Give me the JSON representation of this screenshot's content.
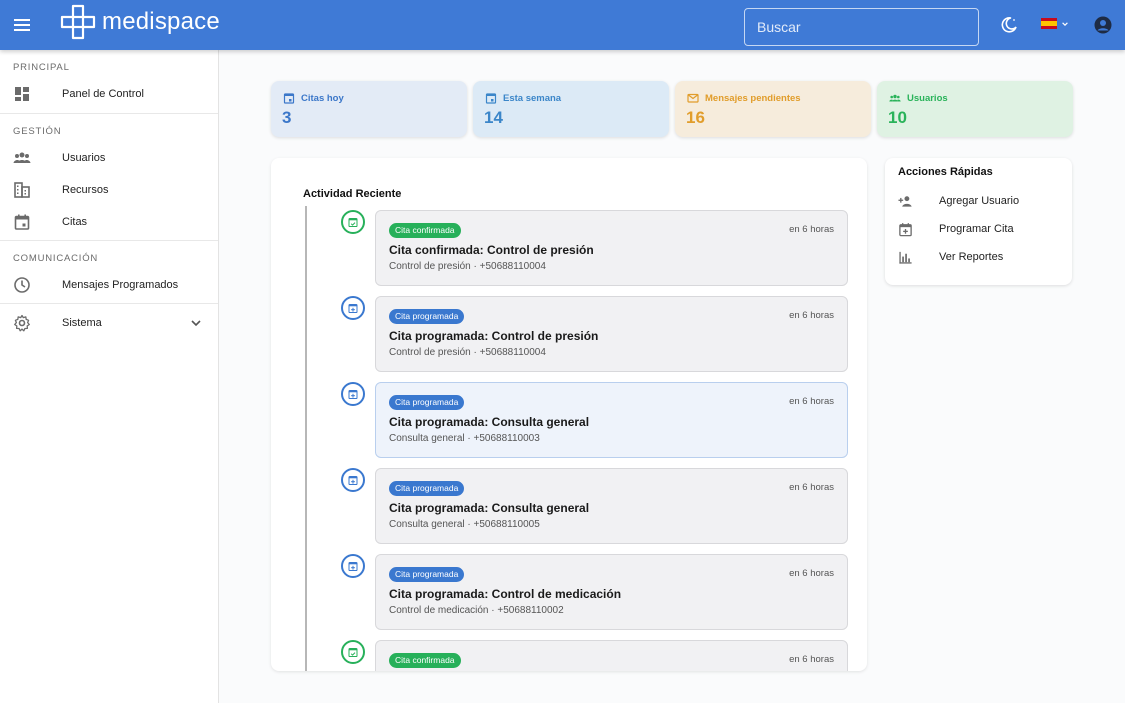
{
  "header": {
    "app_name": "medispace",
    "search_placeholder": "Buscar",
    "colors": {
      "header_bg": "#3f7ad6"
    }
  },
  "sidebar": {
    "sections": [
      "PRINCIPAL",
      "GESTIÓN",
      "COMUNICACIÓN"
    ],
    "items": [
      {
        "label": "Panel de Control",
        "icon": "dashboard-icon"
      },
      {
        "label": "Usuarios",
        "icon": "users-icon"
      },
      {
        "label": "Recursos",
        "icon": "building-icon"
      },
      {
        "label": "Citas",
        "icon": "calendar-icon"
      },
      {
        "label": "Mensajes Programados",
        "icon": "clock-icon"
      },
      {
        "label": "Sistema",
        "icon": "gear-icon"
      }
    ]
  },
  "stats": [
    {
      "label": "Citas hoy",
      "value": "3",
      "color": "#3b77c9",
      "bg": "#e3ebf6"
    },
    {
      "label": "Esta semana",
      "value": "14",
      "color": "#3b86c9",
      "bg": "#dceaf6"
    },
    {
      "label": "Mensajes pendientes",
      "value": "16",
      "color": "#e19d2b",
      "bg": "#f6ecdc"
    },
    {
      "label": "Usuarios",
      "value": "10",
      "color": "#2ab35a",
      "bg": "#dff2e3"
    }
  ],
  "activity": {
    "title": "Actividad Reciente",
    "items": [
      {
        "badge": "Cita confirmada",
        "status": "confirmed",
        "time": "en 6 horas",
        "title": "Cita confirmada: Control de presión",
        "subtitle": "Control de presión · +50688110004"
      },
      {
        "badge": "Cita programada",
        "status": "scheduled",
        "time": "en 6 horas",
        "title": "Cita programada: Control de presión",
        "subtitle": "Control de presión · +50688110004"
      },
      {
        "badge": "Cita programada",
        "status": "scheduled",
        "time": "en 6 horas",
        "title": "Cita programada: Consulta general",
        "subtitle": "Consulta general · +50688110003"
      },
      {
        "badge": "Cita programada",
        "status": "scheduled",
        "time": "en 6 horas",
        "title": "Cita programada: Consulta general",
        "subtitle": "Consulta general · +50688110005"
      },
      {
        "badge": "Cita programada",
        "status": "scheduled",
        "time": "en 6 horas",
        "title": "Cita programada: Control de medicación",
        "subtitle": "Control de medicación · +50688110002"
      },
      {
        "badge": "Cita confirmada",
        "status": "confirmed",
        "time": "en 6 horas",
        "title": "",
        "subtitle": ""
      }
    ],
    "colors": {
      "confirmed": "#27b05a",
      "scheduled": "#3a78cf"
    }
  },
  "quick_actions": {
    "title": "Acciones Rápidas",
    "items": [
      {
        "label": "Agregar Usuario",
        "icon": "add-user-icon"
      },
      {
        "label": "Programar Cita",
        "icon": "calendar-add-icon"
      },
      {
        "label": "Ver Reportes",
        "icon": "bar-chart-icon"
      }
    ]
  }
}
